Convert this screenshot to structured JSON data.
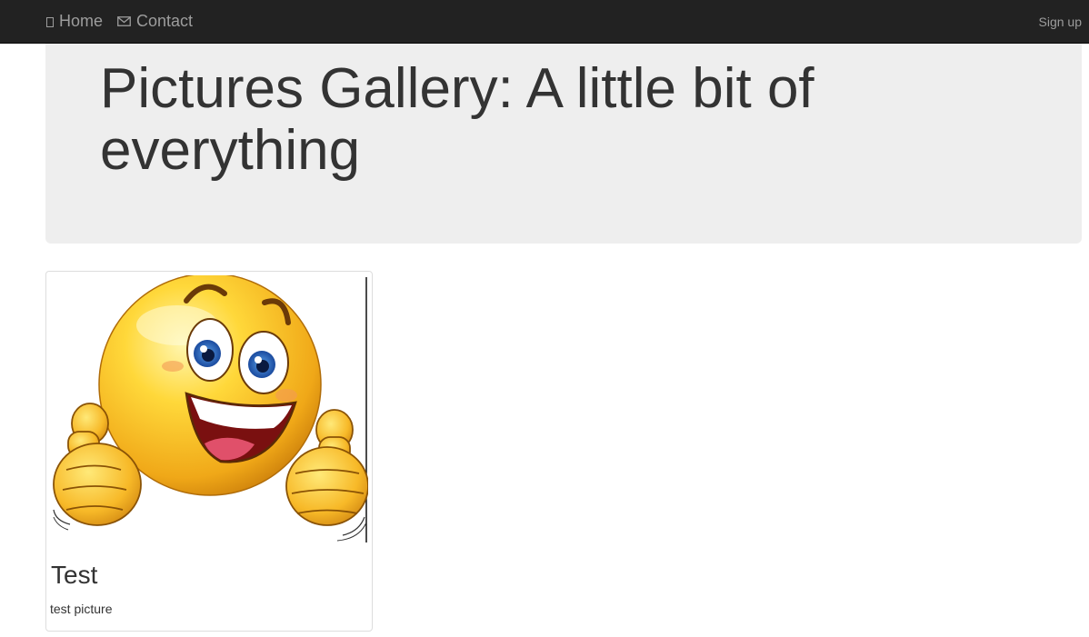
{
  "navbar": {
    "home_label": "Home",
    "contact_label": "Contact",
    "signup_label": "Sign up",
    "home_icon": "home-icon",
    "contact_icon": "envelope-icon"
  },
  "jumbotron": {
    "title": "Pictures Gallery: A little bit of everything"
  },
  "gallery": {
    "items": [
      {
        "title": "Test",
        "description": "test picture",
        "image": "thumbs-up-smiley"
      }
    ]
  },
  "colors": {
    "navbar_bg": "#222222",
    "nav_text": "#9d9d9d",
    "jumbotron_bg": "#eeeeee",
    "text": "#333333"
  }
}
